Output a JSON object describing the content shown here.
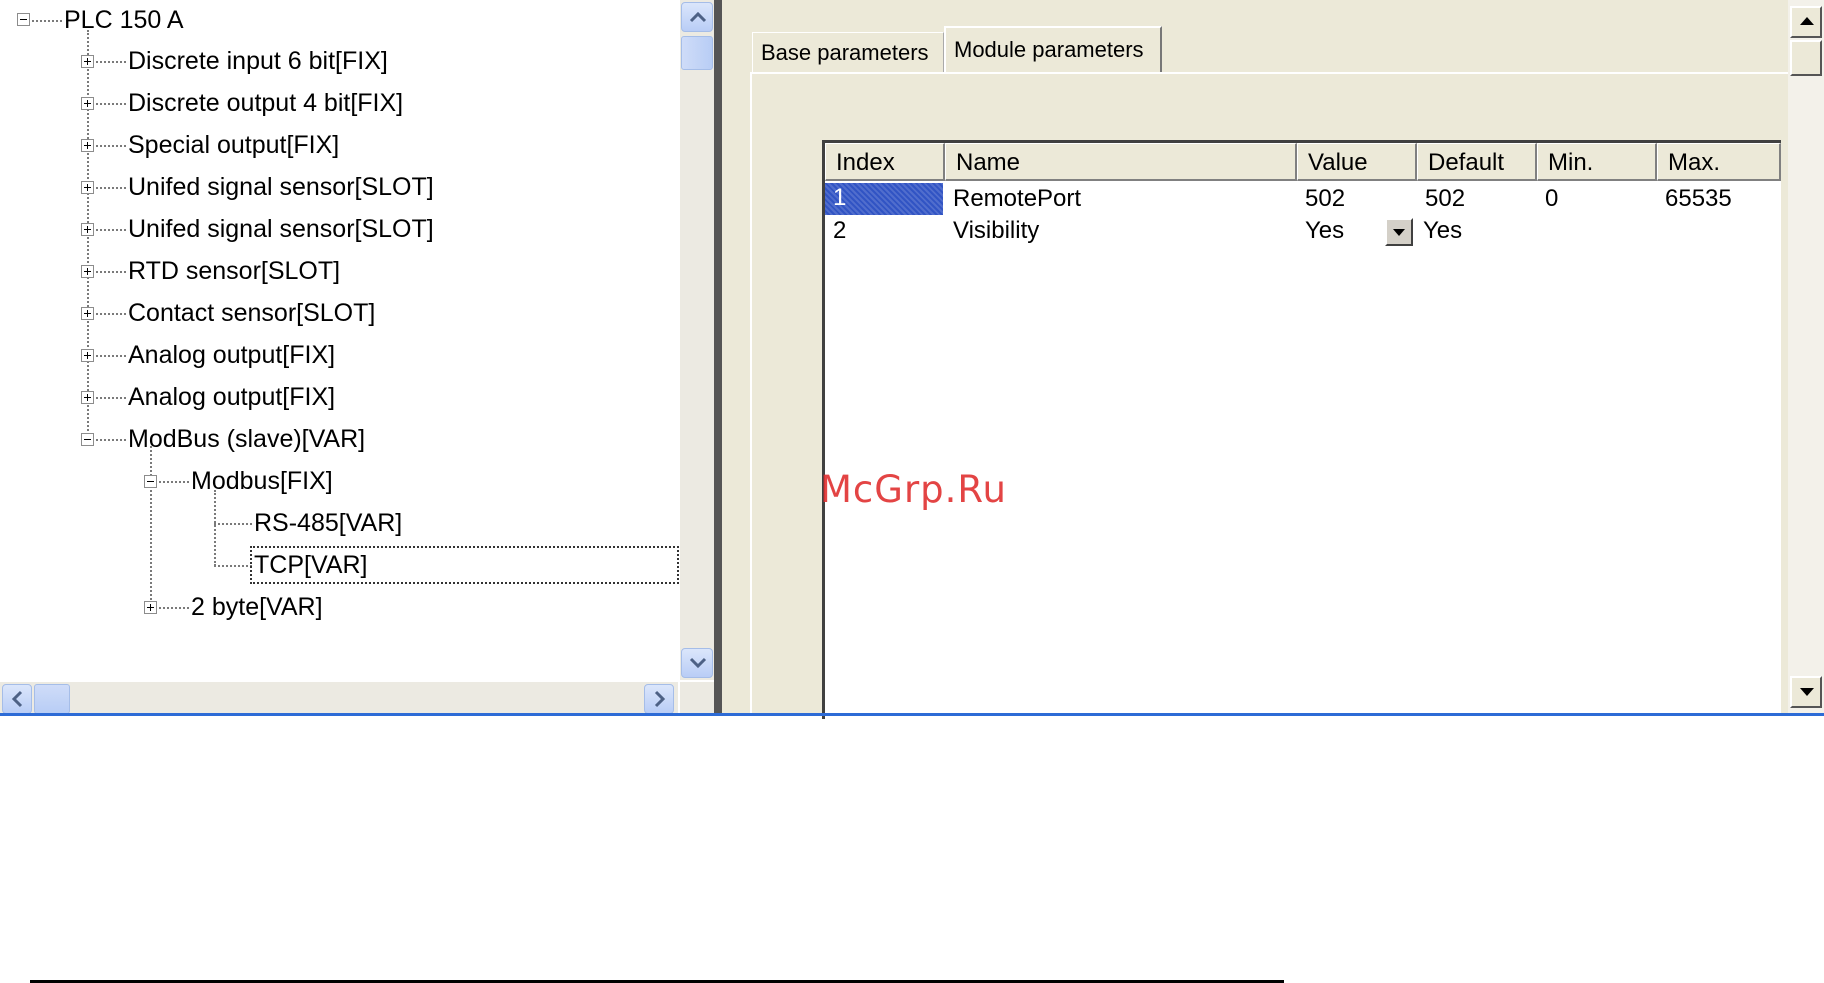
{
  "tree": {
    "root": "PLC 150 A",
    "children": [
      "Discrete input 6 bit[FIX]",
      "Discrete output 4 bit[FIX]",
      "Special output[FIX]",
      "Unifed signal sensor[SLOT]",
      "Unifed signal sensor[SLOT]",
      "RTD sensor[SLOT]",
      "Contact sensor[SLOT]",
      "Analog output[FIX]",
      "Analog output[FIX]",
      "ModBus (slave)[VAR]"
    ],
    "modbus_children": [
      "Modbus[FIX]",
      "2 byte[VAR]"
    ],
    "modbus_fix_children": [
      "RS-485[VAR]",
      "TCP[VAR]"
    ],
    "selected": "TCP[VAR]"
  },
  "tabs": {
    "base": "Base parameters",
    "module": "Module parameters",
    "active": "Module parameters"
  },
  "grid": {
    "columns": [
      "Index",
      "Name",
      "Value",
      "Default",
      "Min.",
      "Max."
    ],
    "rows": [
      [
        "1",
        "RemotePort",
        "502",
        "502",
        "0",
        "65535"
      ],
      [
        "2",
        "Visibility",
        "Yes",
        "Yes",
        "",
        ""
      ]
    ]
  },
  "watermark": "McGrp.Ru",
  "icons": {
    "tree_toggle_expanded": "minus-box-icon",
    "tree_toggle_collapsed": "plus-box-icon",
    "scroll_up": "chevron-up-icon",
    "scroll_down": "chevron-down-icon",
    "scroll_left": "chevron-left-icon",
    "scroll_right": "chevron-right-icon",
    "dropdown": "dropdown-arrow-icon"
  },
  "colors": {
    "selection": "#3154c4",
    "panel_bg": "#ece9d8",
    "watermark": "#e03030",
    "accent_line": "#2d6bd6"
  }
}
